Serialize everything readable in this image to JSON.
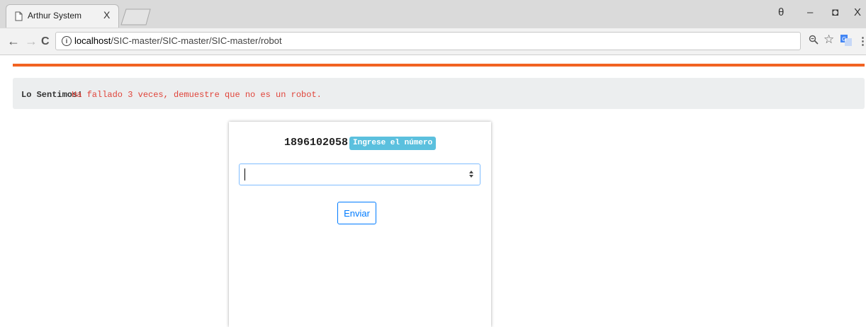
{
  "browser": {
    "tab": {
      "title": "Arthur System",
      "close_label": "X"
    },
    "window_controls": {
      "account": "θ",
      "minimize": "–",
      "restore": "◘",
      "close": "X"
    },
    "nav": {
      "back": "←",
      "forward": "→",
      "reload": "C"
    },
    "url": {
      "host": "localhost",
      "path": "/SIC-master/SIC-master/SIC-master/robot"
    },
    "icons": [
      "zoom-icon",
      "bookmark-star-icon",
      "translate-icon",
      "menu-icon"
    ]
  },
  "colors": {
    "accent": "#f26322",
    "alert_text": "#e0443a",
    "badge_bg": "#5bc0de",
    "primary": "#007bff"
  },
  "alert": {
    "strong": "Lo Sentimos!",
    "message": "Ha fallado 3 veces, demuestre que no es un robot."
  },
  "captcha": {
    "number": "1896102058",
    "badge": "Ingrese el número",
    "input_value": "",
    "submit_label": "Enviar"
  }
}
